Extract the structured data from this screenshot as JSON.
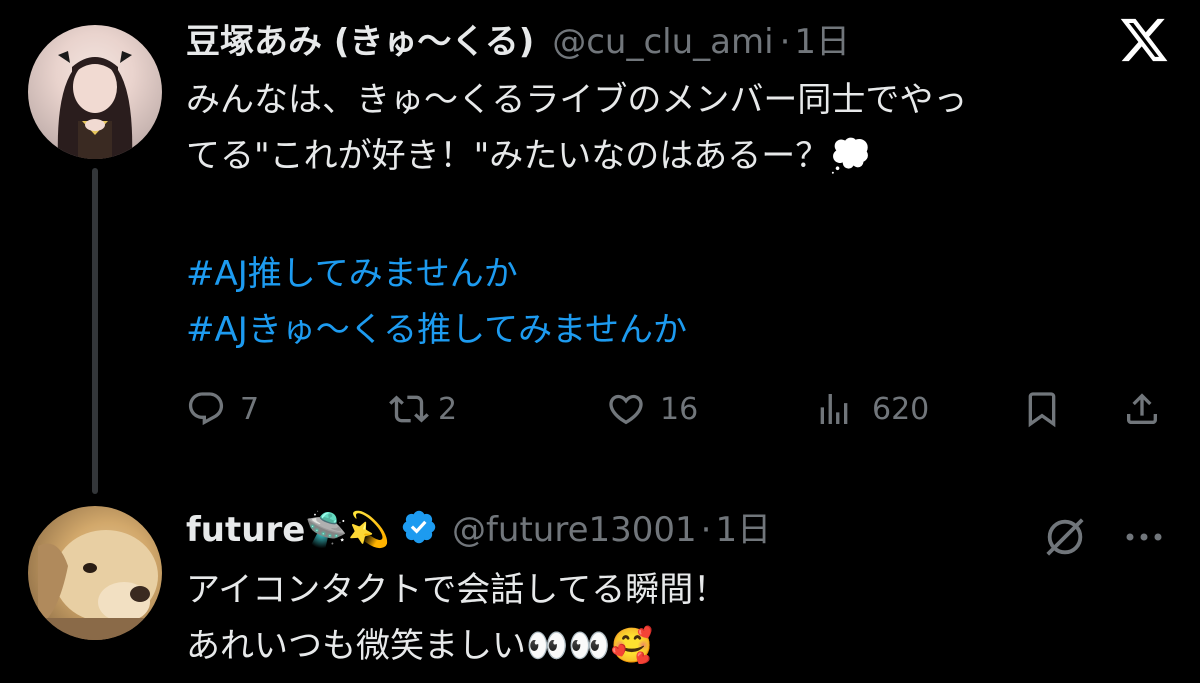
{
  "tweet": {
    "author": {
      "name": "豆塚あみ (きゅ〜くる)",
      "handle": "@cu_clu_ami",
      "time": "1日"
    },
    "text_line1": "みんなは、きゅ〜くるライブのメンバー同士でやっ",
    "text_line2": "てる\"これが好き！\"みたいなのはあるー？💭",
    "hashtags": [
      "#AJ推してみませんか",
      "#AJきゅ〜くる推してみませんか"
    ],
    "actions": {
      "reply_count": "7",
      "retweet_count": "2",
      "like_count": "16",
      "views_count": "620"
    }
  },
  "reply": {
    "author": {
      "name": "future🛸💫",
      "handle": "@future13001",
      "time": "1日"
    },
    "text_line1": "アイコンタクトで会話してる瞬間！",
    "text_line2": "あれいつも微笑ましい👀👀🥰"
  },
  "separator": "·",
  "icons": {
    "reply": "reply-icon",
    "retweet": "retweet-icon",
    "like": "heart-icon",
    "views": "views-icon",
    "bookmark": "bookmark-icon",
    "share": "share-icon",
    "brand": "x-logo-icon",
    "verified": "verified-badge-icon",
    "grok": "grok-icon",
    "more": "more-icon"
  },
  "colors": {
    "background": "#000000",
    "text": "#e7e9ea",
    "muted": "#71767b",
    "hashtag": "#1d9bf0",
    "verified": "#1d9bf0",
    "thread_line": "#333639"
  }
}
